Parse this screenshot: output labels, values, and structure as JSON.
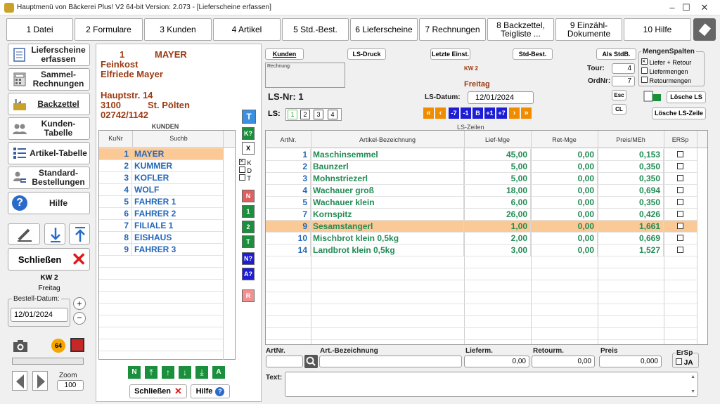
{
  "window": {
    "title": "Hauptmenü von Bäckerei Plus! V2 64-bit Version: 2.073 - [Lieferscheine erfassen]",
    "minimize": "–",
    "maximize": "☐",
    "close": "✕"
  },
  "menu": [
    {
      "label": "1 Datei"
    },
    {
      "label": "2 Formulare"
    },
    {
      "label": "3 Kunden"
    },
    {
      "label": "4 Artikel"
    },
    {
      "label": "5 Std.-Best."
    },
    {
      "label": "6 Lieferscheine"
    },
    {
      "label": "7 Rechnungen"
    },
    {
      "label": "8 Backzettel,\nTeigliste ..."
    },
    {
      "label": "9 Einzähl-\nDokumente"
    },
    {
      "label": "10 Hilfe"
    }
  ],
  "sidebar": {
    "items": [
      {
        "label": "Lieferscheine erfassen"
      },
      {
        "label": "Sammel-Rechnungen"
      },
      {
        "label": "Backzettel"
      },
      {
        "label": "Kunden-Tabelle"
      },
      {
        "label": "Artikel-Tabelle"
      },
      {
        "label": "Standard-Bestellungen"
      },
      {
        "label": "Hilfe"
      }
    ],
    "close_label": "Schließen",
    "kw": "KW 2",
    "day": "Freitag",
    "bestell_label": "Bestell-Datum:",
    "bestell_date": "12/01/2024",
    "zoom_label": "Zoom",
    "zoom_value": "100"
  },
  "customer": {
    "nr": "1",
    "name": "MAYER",
    "line1": "Feinkost",
    "line2": "Elfriede Mayer",
    "street": "Hauptstr. 14",
    "zip": "3100",
    "city": "St. Pölten",
    "phone": "02742/1142"
  },
  "kunden": {
    "title": "KUNDEN",
    "cols": [
      "KuNr",
      "Suchb"
    ],
    "rows": [
      {
        "nr": "1",
        "name": "MAYER"
      },
      {
        "nr": "2",
        "name": "KUMMER"
      },
      {
        "nr": "3",
        "name": "KOFLER"
      },
      {
        "nr": "4",
        "name": "WOLF"
      },
      {
        "nr": "5",
        "name": "FAHRER 1"
      },
      {
        "nr": "6",
        "name": "FAHRER 2"
      },
      {
        "nr": "7",
        "name": "FILIALE 1"
      },
      {
        "nr": "8",
        "name": "EISHAUS"
      },
      {
        "nr": "9",
        "name": "FAHRER 3"
      }
    ],
    "bottom_close": "Schließen",
    "bottom_help": "Hilfe"
  },
  "toolbox": {
    "t": "T",
    "k": "K?",
    "x": "X",
    "kdt": [
      "K",
      "D",
      "T"
    ],
    "n": "N",
    "one": "1",
    "two": "2",
    "tt": "T",
    "nq": "N?",
    "aq": "A?",
    "r": "R"
  },
  "header": {
    "btn_kunden": "Kunden",
    "btn_lsdruck": "LS-Druck",
    "btn_letzte": "Letzte Einst.",
    "btn_stdbest": "Std-Best.",
    "btn_alsstdb": "Als StdB.",
    "rechnung_label": "Rechnung:",
    "kw": "KW 2",
    "day": "Freitag",
    "lsnr": "LS-Nr: 1",
    "lsdatum_label": "LS-Datum:",
    "lsdatum": "12/01/2024",
    "ls_label": "LS:",
    "ls_tabs": [
      "1",
      "2",
      "3",
      "4"
    ],
    "nav": [
      "-7",
      "-1",
      "B",
      "+1",
      "+7"
    ],
    "tour_label": "Tour:",
    "tour": "4",
    "ordnr_label": "OrdNr:",
    "ordnr": "7",
    "esc": "Esc",
    "cl": "CL",
    "loesche_ls": "Lösche LS",
    "loesche_zeile": "Lösche LS-Zeile",
    "mengen_title": "MengenSpalten",
    "mengen": [
      "Liefer + Retour",
      "Liefermengen",
      "Retourmengen"
    ]
  },
  "lszeilen": {
    "title": "LS-Zeilen",
    "cols": [
      "ArtNr.",
      "Artikel-Bezeichnung",
      "Lief-Mge",
      "Ret-Mge",
      "Preis/MEh",
      "ERSp"
    ],
    "rows": [
      {
        "nr": "1",
        "name": "Maschinsemmel",
        "lief": "45,00",
        "ret": "0,00",
        "preis": "0,153"
      },
      {
        "nr": "2",
        "name": "Baunzerl",
        "lief": "5,00",
        "ret": "0,00",
        "preis": "0,350"
      },
      {
        "nr": "3",
        "name": "Mohnstriezerl",
        "lief": "5,00",
        "ret": "0,00",
        "preis": "0,350"
      },
      {
        "nr": "4",
        "name": "Wachauer groß",
        "lief": "18,00",
        "ret": "0,00",
        "preis": "0,694"
      },
      {
        "nr": "5",
        "name": "Wachauer klein",
        "lief": "6,00",
        "ret": "0,00",
        "preis": "0,350"
      },
      {
        "nr": "7",
        "name": "Kornspitz",
        "lief": "26,00",
        "ret": "0,00",
        "preis": "0,426"
      },
      {
        "nr": "9",
        "name": "Sesamstangerl",
        "lief": "1,00",
        "ret": "0,00",
        "preis": "1,661"
      },
      {
        "nr": "10",
        "name": "Mischbrot klein 0,5kg",
        "lief": "2,00",
        "ret": "0,00",
        "preis": "0,669"
      },
      {
        "nr": "14",
        "name": "Landbrot klein 0,5kg",
        "lief": "3,00",
        "ret": "0,00",
        "preis": "1,527"
      }
    ]
  },
  "entry": {
    "artnr_label": "ArtNr.",
    "bez_label": "Art.-Bezeichnung",
    "lieferm_label": "Lieferm.",
    "retourm_label": "Retourm.",
    "preis_label": "Preis",
    "ersp_label": "ErSp",
    "lieferm": "0,00",
    "retourm": "0,00",
    "preis": "0,000",
    "ja": "JA",
    "text_label": "Text:"
  }
}
